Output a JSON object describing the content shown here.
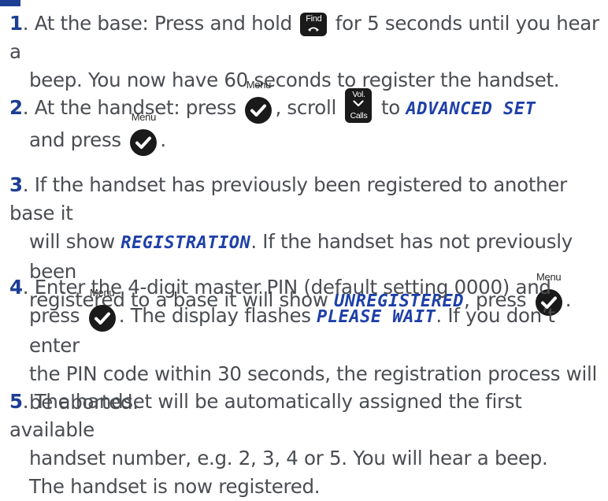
{
  "steps": [
    {
      "number": "1",
      "line1_a": "At the base: Press and hold ",
      "line1_b": " for 5 seconds until you hear a",
      "line2": "beep. You now have 60 seconds to register the handset."
    },
    {
      "number": "2",
      "line1_a": "At the handset: press ",
      "line1_b": ", scroll ",
      "line1_c": " to ",
      "line1_display": "ADVANCED SET",
      "line2_a": "and press ",
      "line2_b": "."
    },
    {
      "number": "3",
      "line1": "If the handset has previously been registered to another base it",
      "line2_a": "will show ",
      "line2_display": "REGISTRATION",
      "line2_b": ". If the handset has not previously been",
      "line3_a": "registered to a base it will show ",
      "line3_display": "UNREGISTERED",
      "line3_b": ", press ",
      "line3_c": "."
    },
    {
      "number": "4",
      "line1": "Enter the 4-digit master PIN (default setting 0000) and",
      "line2_a": "press ",
      "line2_b": ". The display flashes ",
      "line2_display": "PLEASE WAIT",
      "line2_c": ". If you don’t enter",
      "line3": "the PIN code within 30 seconds, the registration process will",
      "line4": "be aborted."
    },
    {
      "number": "5",
      "line1": "The handset will be automatically assigned the first available",
      "line2": "handset number, e.g. 2, 3, 4 or 5. You will hear a beep.",
      "line3": "The handset is now registered."
    }
  ],
  "keys": {
    "menu_label": "Menu",
    "find_label": "Find",
    "vol_label": "Vol.",
    "calls_label": "Calls"
  },
  "icons": {
    "menu_key": "menu-ok-check-icon",
    "find_key": "find-handset-icon",
    "scroll_key": "vol-calls-down-icon"
  },
  "colors": {
    "step_number": "#1c3f94",
    "display_text": "#1e40a8",
    "body_text": "#4a4d52"
  }
}
